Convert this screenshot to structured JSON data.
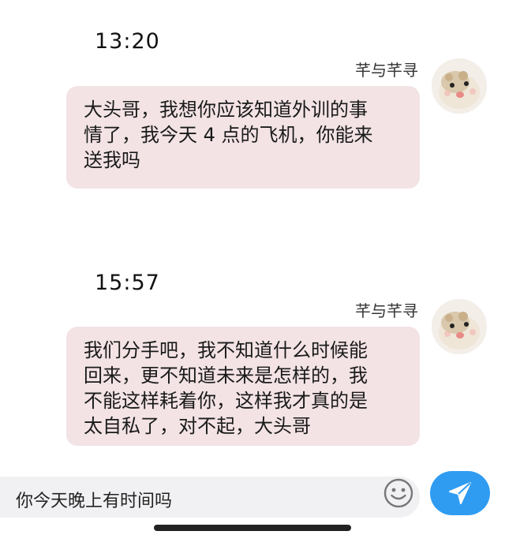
{
  "messages": [
    {
      "time": "13:20",
      "sender": "芊与芊寻",
      "lines": [
        "大头哥，我想你应该知道外训的事",
        "情了，我今天 4 点的飞机，你能来",
        "送我吗"
      ]
    },
    {
      "time": "15:57",
      "sender": "芊与芊寻",
      "lines": [
        "我们分手吧，我不知道什么时候能",
        "回来，更不知道未来是怎样的，我",
        "不能这样耗着你，这样我才真的是",
        "太自私了，对不起，大头哥"
      ]
    }
  ],
  "composer": {
    "input_value": "你今天晚上有时间吗"
  },
  "icons": {
    "avatar": "hamster-avatar-icon",
    "emoji": "smiley-icon",
    "send": "send-icon"
  },
  "colors": {
    "bubble": "#f3e3e5",
    "send_button": "#2f9cf2",
    "input_background": "#f1f1f3"
  }
}
